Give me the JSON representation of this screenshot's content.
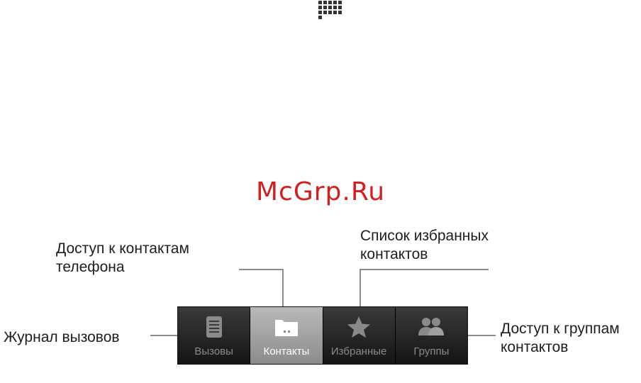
{
  "watermark": "McGrp.Ru",
  "callouts": {
    "contacts_access": [
      "Доступ к контактам",
      "телефона"
    ],
    "favorites_list": [
      "Список избранных",
      "контактов"
    ],
    "call_log": "Журнал вызовов",
    "groups_access": [
      "Доступ к группам",
      "контактов"
    ]
  },
  "tabs": [
    {
      "label": "Вызовы",
      "icon": "call-log-icon",
      "active": false
    },
    {
      "label": "Контакты",
      "icon": "contacts-folder-icon",
      "active": true
    },
    {
      "label": "Избранные",
      "icon": "star-icon",
      "active": false
    },
    {
      "label": "Группы",
      "icon": "groups-icon",
      "active": false
    }
  ],
  "colors": {
    "watermark": "#d21f1f",
    "tab_bar": "#141414",
    "tab_active": "#a3a3a3",
    "callout_line": "#8c8c8c"
  }
}
